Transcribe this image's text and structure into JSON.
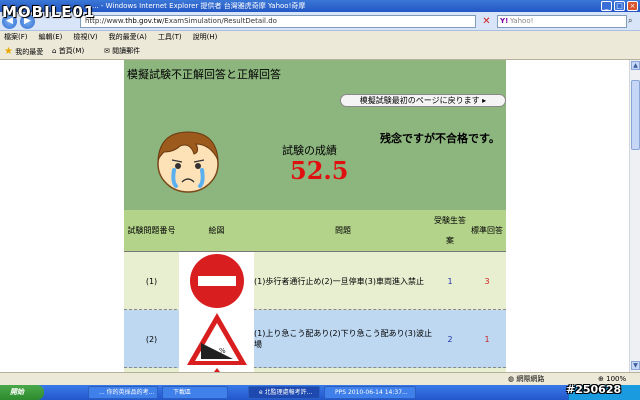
{
  "browser": {
    "window_title": "... - Windows Internet Explorer 提供者 台灣雅虎奇摩 Yahoo!奇摩",
    "address_prefix": "http://www.",
    "address_domain": "thb.gov.tw",
    "address_path": "/ExamSimulation/ResultDetail.do",
    "search_placeholder": "Yahoo!",
    "menu": [
      "檔案(F)",
      "編輯(E)",
      "檢視(V)",
      "我的最愛(A)",
      "工具(T)",
      "說明(H)"
    ],
    "favorites": {
      "label": "我的最愛",
      "home": "首頁(M)",
      "item": "閱讀郵件"
    },
    "status": {
      "zone": "網際網路",
      "zoom": "100%"
    }
  },
  "watermark": {
    "logo": "MOBILE01",
    "id": "#250628"
  },
  "exam": {
    "title": "模擬試験不正解回答と正解回答",
    "back_button": "模擬試験最初のページに戻ります",
    "score_label": "試験の成績",
    "score": "52.5",
    "result_message": "残念ですが不合格です。",
    "columns": {
      "number": "試験問題番号",
      "picture": "絵図",
      "question": "問題",
      "answer": "受験生答案",
      "correct": "標準回答"
    },
    "rows": [
      {
        "number": "(1)",
        "sign": "no-entry-sign-icon",
        "question": "(1)歩行者通行止め(2)一旦停車(3)車両進入禁止",
        "answer": "1",
        "correct": "3"
      },
      {
        "number": "(2)",
        "sign": "steep-slope-sign-icon",
        "question": "(1)上り急こう配あり(2)下り急こう配あり(3)波止場",
        "answer": "2",
        "correct": "1"
      }
    ]
  },
  "taskbar": {
    "start": "開始",
    "tasks": [
      "... 你的英採品的考...",
      "下載區",
      "e 北監理處報考許...",
      "PPS 2010-06-14 14:37..."
    ]
  },
  "colors": {
    "header_green": "#8db67f",
    "column_green": "#b3d38b",
    "row_light": "#e8eed0",
    "row_blue": "#bed8f2",
    "score_red": "#e01010"
  }
}
